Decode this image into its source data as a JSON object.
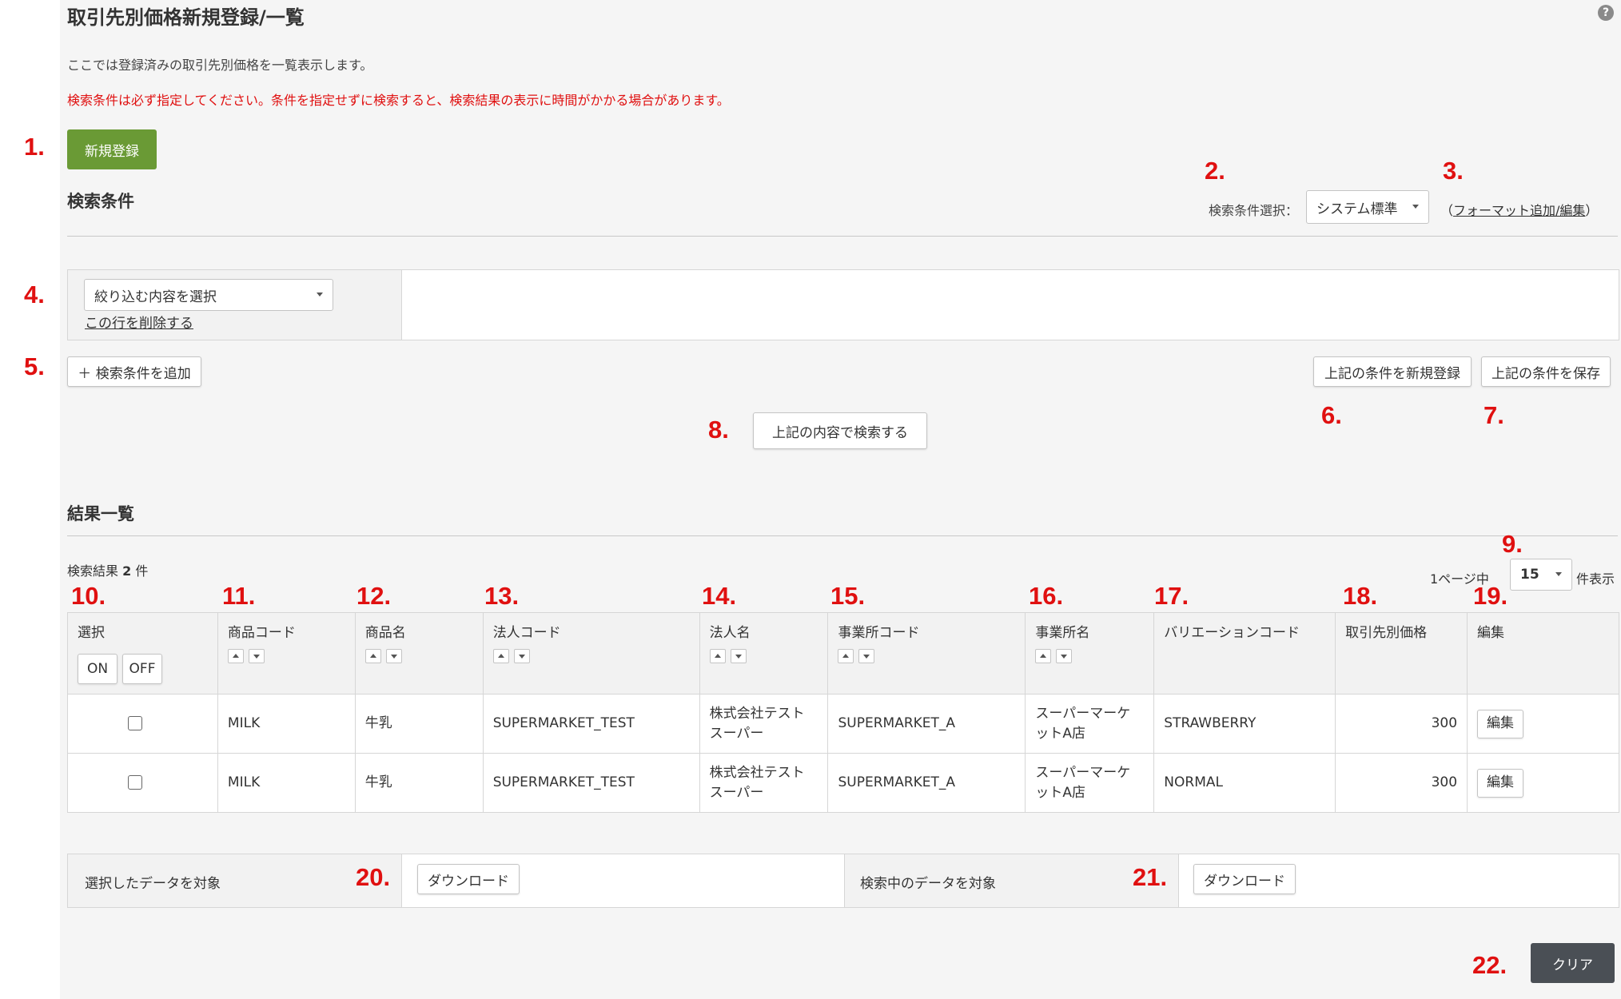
{
  "page": {
    "title": "取引先別価格新規登録/一覧",
    "help": "?",
    "description": "ここでは登録済みの取引先別価格を一覧表示します。",
    "warning": "検索条件は必ず指定してください。条件を指定せずに検索すると、検索結果の表示に時間がかかる場合があります。",
    "new_button": "新規登録"
  },
  "search": {
    "title": "検索条件",
    "preset_label": "検索条件選択：",
    "preset_value": "システム標準",
    "format_link_open": "（",
    "format_link": "フォーマット追加/編集",
    "format_link_close": "）",
    "filter_select": "絞り込む内容を選択",
    "delete_row": "この行を削除する",
    "add_condition": "＋ 検索条件を追加",
    "save_new": "上記の条件を新規登録",
    "save": "上記の条件を保存",
    "search_button": "上記の内容で検索する"
  },
  "results": {
    "title": "結果一覧",
    "count_label": "検索結果",
    "count": "2",
    "count_unit": "件",
    "per_page_prefix": "1ページ中",
    "per_page_value": "15",
    "per_page_suffix": "件表示",
    "columns": {
      "select": "選択",
      "on": "ON",
      "off": "OFF",
      "item_code": "商品コード",
      "item_name": "商品名",
      "corp_code": "法人コード",
      "corp_name": "法人名",
      "office_code": "事業所コード",
      "office_name": "事業所名",
      "variation_code": "バリエーションコード",
      "price": "取引先別価格",
      "edit": "編集"
    },
    "rows": [
      {
        "item_code": "MILK",
        "item_name": "牛乳",
        "corp_code": "SUPERMARKET_TEST",
        "corp_name_1": "株式会社テスト",
        "corp_name_2": "スーパー",
        "office_code": "SUPERMARKET_A",
        "office_name_1": "スーパーマーケ",
        "office_name_2": "ットA店",
        "variation_code": "STRAWBERRY",
        "price": "300",
        "edit": "編集"
      },
      {
        "item_code": "MILK",
        "item_name": "牛乳",
        "corp_code": "SUPERMARKET_TEST",
        "corp_name_1": "株式会社テスト",
        "corp_name_2": "スーパー",
        "office_code": "SUPERMARKET_A",
        "office_name_1": "スーパーマーケ",
        "office_name_2": "ットA店",
        "variation_code": "NORMAL",
        "price": "300",
        "edit": "編集"
      }
    ]
  },
  "download": {
    "selected_label": "選択したデータを対象",
    "searched_label": "検索中のデータを対象",
    "button": "ダウンロード"
  },
  "clear_button": "クリア",
  "markers": [
    "1.",
    "2.",
    "3.",
    "4.",
    "5.",
    "6.",
    "7.",
    "8.",
    "9.",
    "10.",
    "11.",
    "12.",
    "13.",
    "14.",
    "15.",
    "16.",
    "17.",
    "18.",
    "19.",
    "20.",
    "21.",
    "22."
  ],
  "colors": {
    "accent_green": "#6a9a35",
    "warning_red": "#e01010",
    "marker_red": "#e01010",
    "dark_button": "#4a4f55"
  }
}
